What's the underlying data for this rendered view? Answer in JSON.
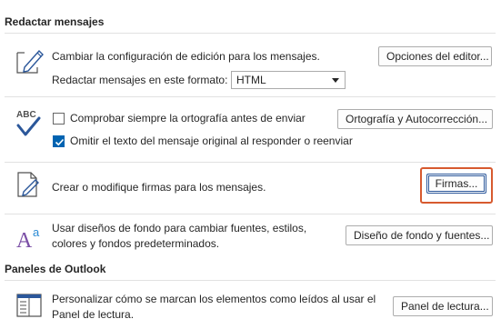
{
  "compose": {
    "title": "Redactar mensajes",
    "edit_text": "Cambiar la configuración de edición para los mensajes.",
    "editor_button": "Opciones del editor...",
    "format_label": "Redactar mensajes en este formato:",
    "format_value": "HTML",
    "spellcheck_label": "Comprobar siempre la ortografía antes de enviar",
    "spellcheck_checked": false,
    "spelling_button": "Ortografía y Autocorrección...",
    "omit_label": "Omitir el texto del mensaje original al responder o reenviar",
    "omit_checked": true,
    "signature_text": "Crear o modifique firmas para los mensajes.",
    "signature_button": "Firmas...",
    "stationery_text_line1": "Usar diseños de fondo para cambiar fuentes, estilos,",
    "stationery_text_line2": "colores y fondos predeterminados.",
    "stationery_button": "Diseño de fondo y fuentes..."
  },
  "panes": {
    "title": "Paneles de Outlook",
    "reading_text_line1": "Personalizar cómo se marcan los elementos como leídos al usar el",
    "reading_text_line2": "Panel de lectura.",
    "reading_button": "Panel de lectura..."
  },
  "colors": {
    "accent": "#2b579a",
    "highlight": "#d75a2f",
    "checkbox_checked": "#0063b1"
  }
}
